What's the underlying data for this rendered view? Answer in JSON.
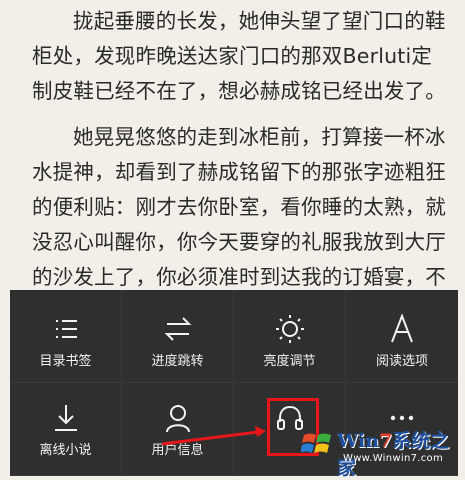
{
  "reader": {
    "paragraph1": "拢起垂腰的长发，她伸头望了望门口的鞋柜处，发现昨晚送达家门口的那双Berluti定制皮鞋已经不在了，想必赫成铭已经出发了。",
    "paragraph2": "她晃晃悠悠的走到冰柜前，打算接一杯冰水提神，却看到了赫成铭留下的那张字迹粗狂的便利贴：刚才去你卧室，看你睡的太熟，就没忍心叫醒你，你今天要穿的礼服我放到大厅的沙发上了，你必须准时到达我的订婚宴，不"
  },
  "menu": {
    "items": [
      {
        "label": "目录书签",
        "icon": "list-icon"
      },
      {
        "label": "进度跳转",
        "icon": "swap-arrows-icon"
      },
      {
        "label": "亮度调节",
        "icon": "brightness-icon"
      },
      {
        "label": "阅读选项",
        "icon": "font-icon"
      },
      {
        "label": "离线小说",
        "icon": "download-icon"
      },
      {
        "label": "用户信息",
        "icon": "user-icon"
      },
      {
        "label": "",
        "icon": "headphones-icon"
      },
      {
        "label": "",
        "icon": "more-icon"
      }
    ]
  },
  "watermark": {
    "title_prefix": "Win",
    "title_seven": "7",
    "title_suffix": "系统之家",
    "url": "Www.Winwin7.com"
  },
  "colors": {
    "panel": "#2f2f2f",
    "page": "#f1efe7",
    "highlight": "#e8161a"
  }
}
